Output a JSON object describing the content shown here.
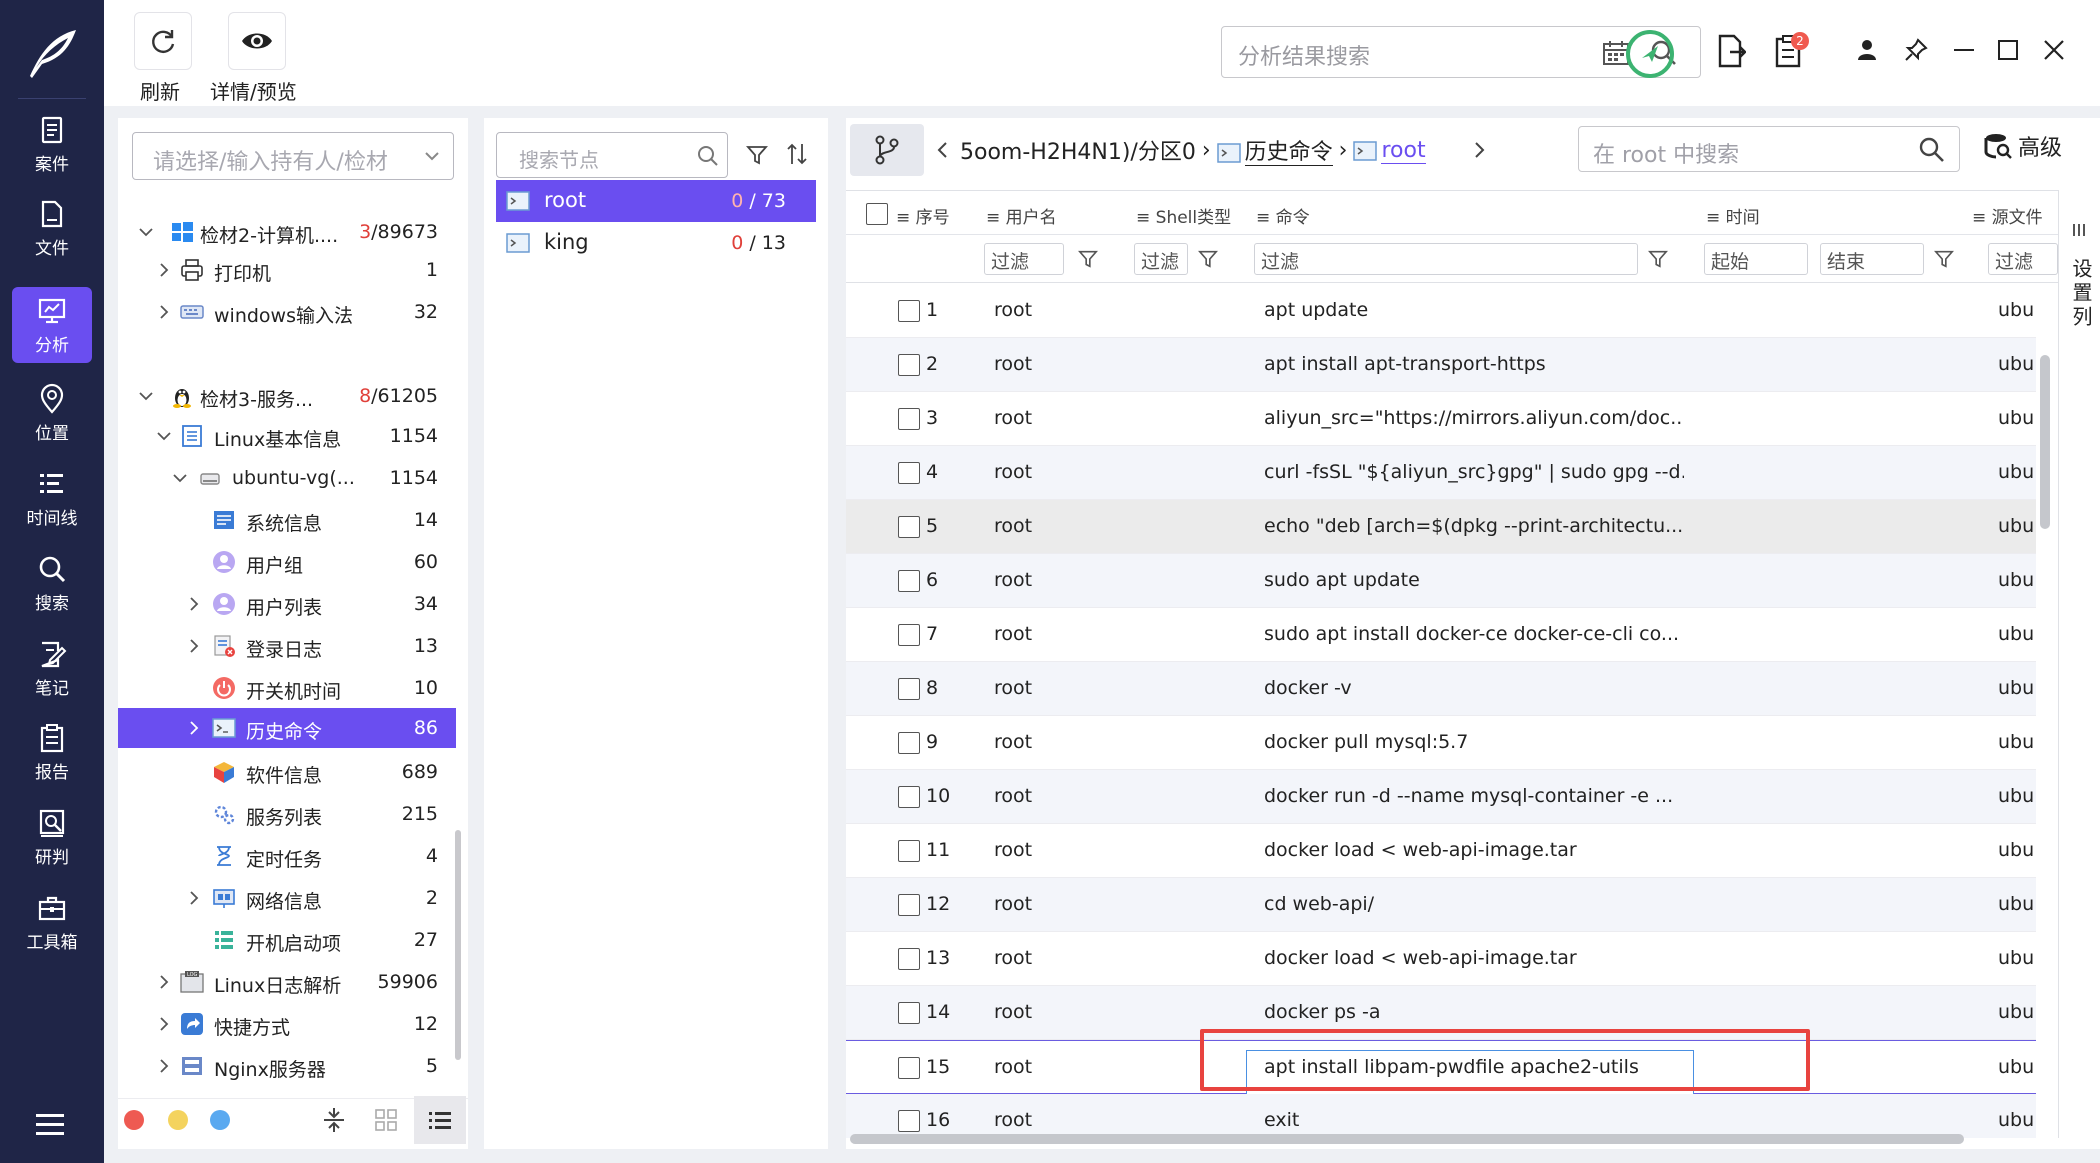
{
  "toolbar": {
    "refresh_label": "刷新",
    "preview_label": "详情/预览",
    "search_placeholder": "分析结果搜索",
    "notification_count": "2"
  },
  "nav": {
    "items": [
      {
        "label": "案件",
        "icon": "case-icon"
      },
      {
        "label": "文件",
        "icon": "file-icon"
      },
      {
        "label": "分析",
        "icon": "analysis-icon",
        "active": true
      },
      {
        "label": "位置",
        "icon": "location-icon"
      },
      {
        "label": "时间线",
        "icon": "timeline-icon"
      },
      {
        "label": "搜索",
        "icon": "search-icon"
      },
      {
        "label": "笔记",
        "icon": "note-icon"
      },
      {
        "label": "报告",
        "icon": "report-icon"
      },
      {
        "label": "研判",
        "icon": "judge-icon"
      },
      {
        "label": "工具箱",
        "icon": "toolbox-icon"
      }
    ]
  },
  "tree": {
    "holder_placeholder": "请选择/输入持有人/检材",
    "rows": [
      {
        "label": "检材2-计算机....",
        "count_red": "3",
        "count": "/89673"
      },
      {
        "label": "打印机",
        "count": "1"
      },
      {
        "label": "windows输入法",
        "count": "32"
      },
      {
        "label": "检材3-服务...",
        "count_red": "8",
        "count": "/61205"
      },
      {
        "label": "Linux基本信息",
        "count": "1154"
      },
      {
        "label": "ubuntu-vg(...",
        "count": "1154"
      },
      {
        "label": "系统信息",
        "count": "14"
      },
      {
        "label": "用户组",
        "count": "60"
      },
      {
        "label": "用户列表",
        "count": "34"
      },
      {
        "label": "登录日志",
        "count": "13"
      },
      {
        "label": "开关机时间",
        "count": "10"
      },
      {
        "label": "历史命令",
        "count": "86"
      },
      {
        "label": "软件信息",
        "count": "689"
      },
      {
        "label": "服务列表",
        "count": "215"
      },
      {
        "label": "定时任务",
        "count": "4"
      },
      {
        "label": "网络信息",
        "count": "2"
      },
      {
        "label": "开机启动项",
        "count": "27"
      },
      {
        "label": "Linux日志解析",
        "count": "59906"
      },
      {
        "label": "快捷方式",
        "count": "12"
      },
      {
        "label": "Nginx服务器",
        "count": "5"
      }
    ]
  },
  "nodes": {
    "search_placeholder": "搜索节点",
    "items": [
      {
        "name": "root",
        "sel": "0",
        "total": " / 73"
      },
      {
        "name": "king",
        "sel": "0",
        "total": " / 13"
      }
    ]
  },
  "breadcrumb": {
    "path": "5oom-H2H4N1)/分区0",
    "seg2": "历史命令",
    "seg3": "root",
    "search_placeholder": "在 root 中搜索",
    "advanced_label": "高级"
  },
  "grid": {
    "headers": {
      "seq": "序号",
      "user": "用户名",
      "shell": "Shell类型",
      "cmd": "命令",
      "time": "时间",
      "src": "源文件"
    },
    "filter_label": "过滤",
    "filter_start": "起始",
    "filter_end": "结束",
    "col_settings_label": "设置列",
    "rows": [
      {
        "seq": "1",
        "user": "root",
        "cmd": "apt update",
        "src": "ubu"
      },
      {
        "seq": "2",
        "user": "root",
        "cmd": "apt install apt-transport-https",
        "src": "ubu"
      },
      {
        "seq": "3",
        "user": "root",
        "cmd": "aliyun_src=\"https://mirrors.aliyun.com/doc...",
        "src": "ubu"
      },
      {
        "seq": "4",
        "user": "root",
        "cmd": "curl -fsSL \"${aliyun_src}gpg\" | sudo gpg --d...",
        "src": "ubu"
      },
      {
        "seq": "5",
        "user": "root",
        "cmd": "echo \"deb [arch=$(dpkg --print-architectu...",
        "src": "ubu"
      },
      {
        "seq": "6",
        "user": "root",
        "cmd": "sudo apt update",
        "src": "ubu"
      },
      {
        "seq": "7",
        "user": "root",
        "cmd": "sudo apt install docker-ce docker-ce-cli co...",
        "src": "ubu"
      },
      {
        "seq": "8",
        "user": "root",
        "cmd": "docker -v",
        "src": "ubu"
      },
      {
        "seq": "9",
        "user": "root",
        "cmd": "docker pull mysql:5.7",
        "src": "ubu"
      },
      {
        "seq": "10",
        "user": "root",
        "cmd": "docker run -d --name mysql-container -e ...",
        "src": "ubu"
      },
      {
        "seq": "11",
        "user": "root",
        "cmd": "docker load < web-api-image.tar",
        "src": "ubu"
      },
      {
        "seq": "12",
        "user": "root",
        "cmd": "cd web-api/",
        "src": "ubu"
      },
      {
        "seq": "13",
        "user": "root",
        "cmd": "docker load < web-api-image.tar",
        "src": "ubu"
      },
      {
        "seq": "14",
        "user": "root",
        "cmd": "docker ps -a",
        "src": "ubu"
      },
      {
        "seq": "15",
        "user": "root",
        "cmd": "apt install libpam-pwdfile apache2-utils",
        "src": "ubu"
      },
      {
        "seq": "16",
        "user": "root",
        "cmd": "exit",
        "src": "ubu"
      }
    ]
  },
  "colors": {
    "accent": "#6a4ef0",
    "nav_bg": "#1f2547",
    "highlight": "#e8433f"
  }
}
